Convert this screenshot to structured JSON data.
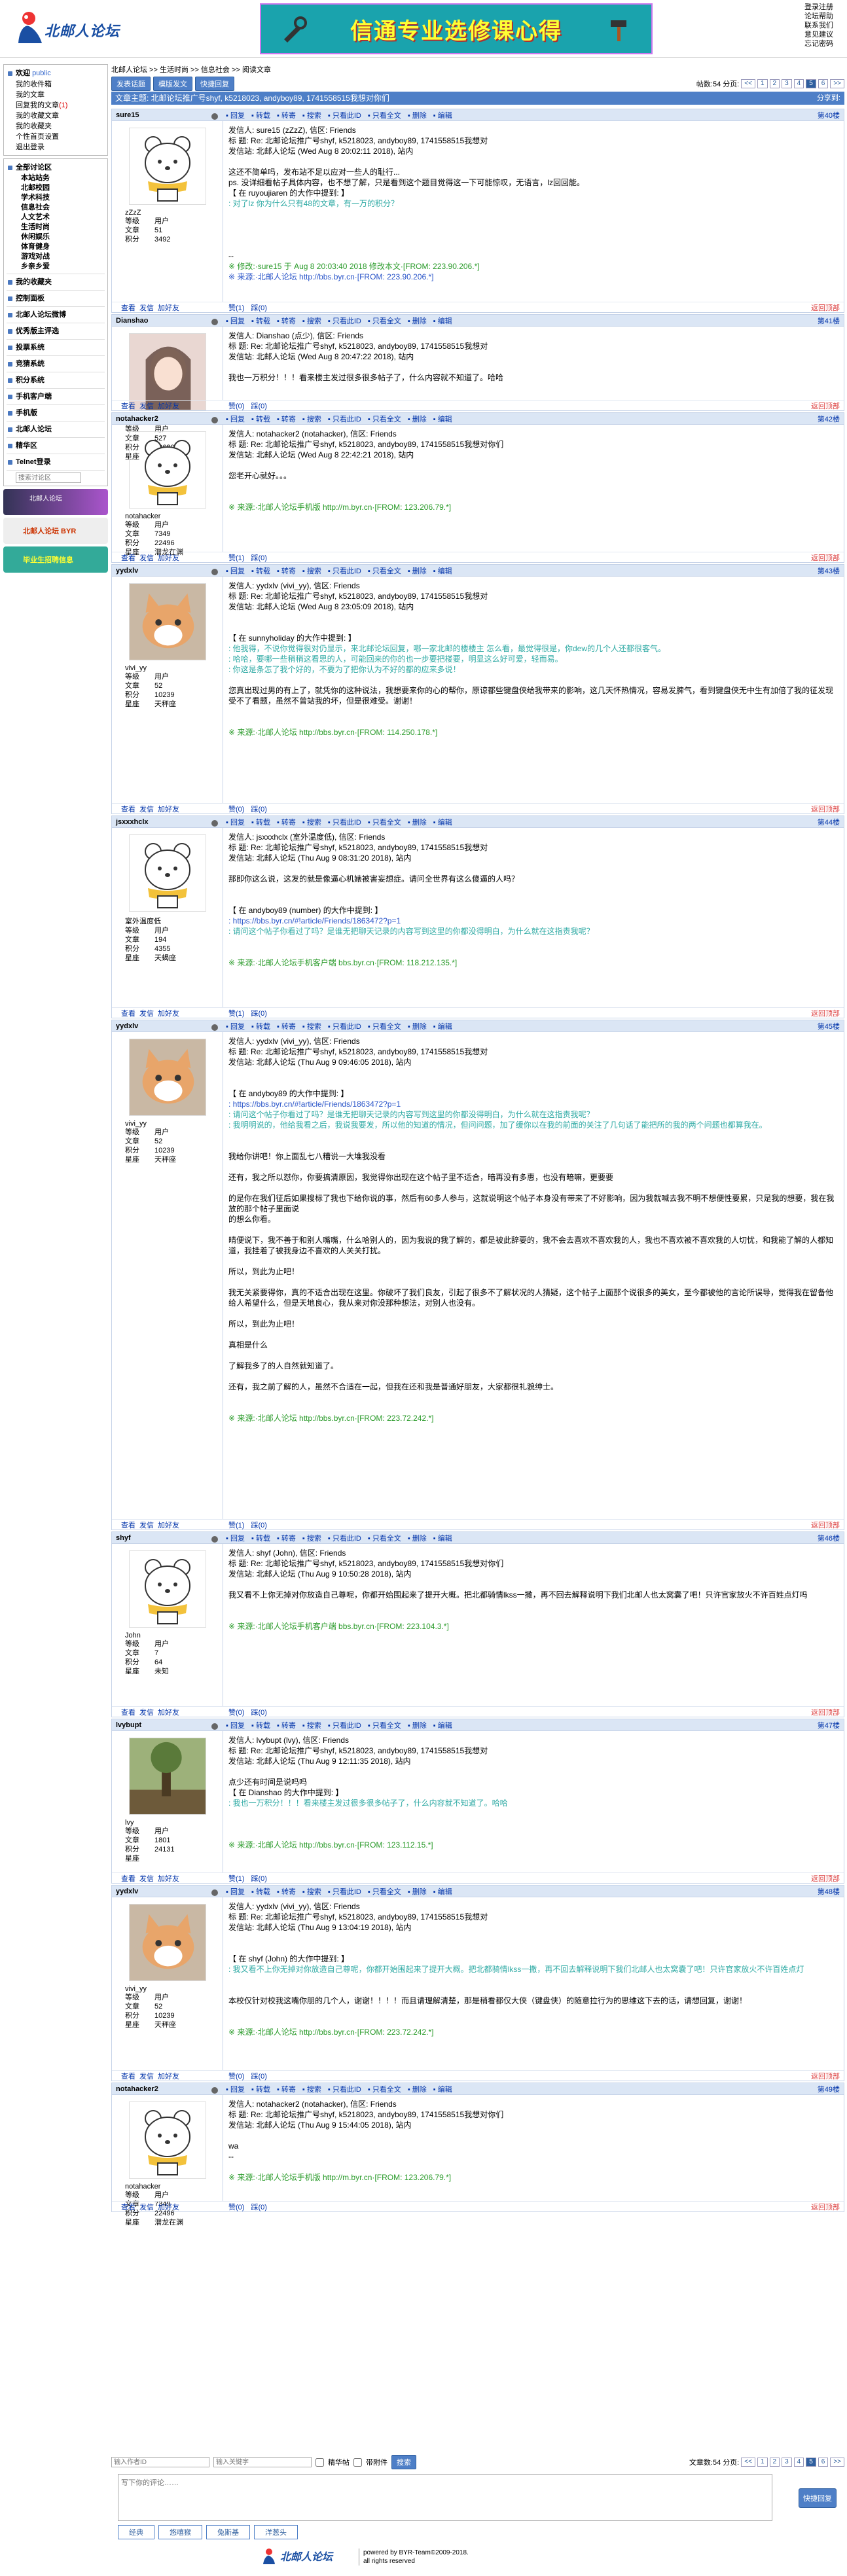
{
  "header": {
    "logo_text": "北邮人论坛",
    "banner_text": "信通专业选修课心得",
    "toplinks": [
      "登录注册",
      "论坛帮助",
      "联系我们",
      "意见建议",
      "忘记密码"
    ]
  },
  "sidebar": {
    "welcome": "欢迎",
    "welcome_user": "public",
    "user_links": [
      "我的收件箱",
      "我的文章",
      "回复我的文章",
      "我的收藏文章",
      "我的收藏夹",
      "个性首页设置",
      "退出登录"
    ],
    "reply_count": "(1)",
    "all_boards": "全部讨论区",
    "boards": [
      "本站站务",
      "北邮校园",
      "学术科技",
      "信息社会",
      "人文艺术",
      "生活时尚",
      "休闲娱乐",
      "体育健身",
      "游戏对战",
      "乡亲乡爱"
    ],
    "my_fav": "我的收藏夹",
    "ctrl": "控制面板",
    "sections": [
      "北邮人论坛微博",
      "优秀版主评选",
      "投票系统",
      "竞猜系统",
      "积分系统",
      "手机客户端",
      "手机版",
      "北邮人论坛",
      "精华区",
      "Telnet登录"
    ],
    "search_placeholder": "搜索讨论区",
    "ad1": "北邮人论坛",
    "ad2": "北邮人论坛 BYR",
    "ad3": "毕业生招聘信息"
  },
  "main": {
    "breadcrumb": "北邮人论坛 >> 生活时尚 >> 信息社会 >> 阅读文章",
    "buttons": [
      "发表话题",
      "模版发文",
      "快捷回复"
    ],
    "post_count": "帖数:54",
    "pages_label": "分页:",
    "pages": [
      "<<",
      "1",
      "2",
      "3",
      "4",
      "5",
      "6",
      ">>"
    ],
    "thread_title": "文章主题: 北邮论坛推广号shyf, k5218023, andyboy89, 1741558515我想对你们",
    "share": "分享到:",
    "tools": [
      "回复",
      "转载",
      "转寄",
      "搜索",
      "只看此ID",
      "只看全文",
      "删除",
      "编辑"
    ],
    "posts": [
      {
        "user": "sure15",
        "floor": "第40楼",
        "nick": "zZzZ",
        "level": "用户",
        "articles": "51",
        "score": "3492",
        "lines": [
          {
            "t": "发信人: sure15 (zZzZ), 信区: Friends",
            "c": ""
          },
          {
            "t": "标  题: Re: 北邮论坛推广号shyf, k5218023, andyboy89, 1741558515我想对",
            "c": ""
          },
          {
            "t": "发信站: 北邮人论坛 (Wed Aug  8 20:02:11 2018), 站内",
            "c": ""
          },
          {
            "t": "",
            "c": ""
          },
          {
            "t": "这还不简单吗，发布站不足以应对一些人的耻行...",
            "c": ""
          },
          {
            "t": "ps. 没详细看帖子具体内容，也不想了解，只是看到这个题目觉得这一下可能惊叹，无语言，lz回回能。",
            "c": ""
          },
          {
            "t": "【 在 ruyoujiaren 的大作中提到: 】",
            "c": ""
          },
          {
            "t": ": 对了lz 你为什么只有48的文章，有一万的积分？",
            "c": "quote"
          },
          {
            "t": "",
            "c": ""
          },
          {
            "t": "",
            "c": ""
          },
          {
            "t": "",
            "c": ""
          },
          {
            "t": "",
            "c": ""
          },
          {
            "t": "--",
            "c": ""
          },
          {
            "t": "※ 修改:·sure15 于 Aug  8 20:03:40 2018 修改本文·[FROM: 223.90.206.*]",
            "c": "green"
          },
          {
            "t": "※ 来源:·北邮人论坛 http://bbs.byr.cn·[FROM: 223.90.206.*]",
            "c": "blue"
          }
        ],
        "ava": "bear"
      },
      {
        "user": "Dianshao",
        "floor": "第41楼",
        "nick": "点少",
        "level": "用户",
        "articles": "527",
        "score": "10680",
        "star": "新手楼",
        "lines": [
          {
            "t": "发信人: Dianshao (点少), 信区: Friends",
            "c": ""
          },
          {
            "t": "标  题: Re: 北邮论坛推广号shyf, k5218023, andyboy89, 1741558515我想对",
            "c": ""
          },
          {
            "t": "发信站: 北邮人论坛 (Wed Aug  8 20:47:22 2018), 站内",
            "c": ""
          },
          {
            "t": "",
            "c": ""
          },
          {
            "t": "我也一万积分！！！看来楼主发过很多很多帖子了，什么内容就不知道了。哈哈",
            "c": ""
          },
          {
            "t": "",
            "c": ""
          },
          {
            "t": "",
            "c": ""
          },
          {
            "t": "",
            "c": ""
          },
          {
            "t": "※ 来源:·北邮人论坛 http://bbs.byr.cn·[FROM: 111.194.50.*]",
            "c": "red"
          }
        ],
        "ava": "girl"
      },
      {
        "user": "notahacker2",
        "floor": "第42楼",
        "nick": "notahacker",
        "level": "用户",
        "articles": "7349",
        "score": "22496",
        "star": "潜龙在渊",
        "lines": [
          {
            "t": "发信人: notahacker2 (notahacker), 信区: Friends",
            "c": ""
          },
          {
            "t": "标  题: Re: 北邮论坛推广号shyf, k5218023, andyboy89, 1741558515我想对你们",
            "c": ""
          },
          {
            "t": "发信站: 北邮人论坛 (Wed Aug  8 22:42:21 2018), 站内",
            "c": ""
          },
          {
            "t": "",
            "c": ""
          },
          {
            "t": "您老开心就好。。。",
            "c": ""
          },
          {
            "t": "",
            "c": ""
          },
          {
            "t": "",
            "c": ""
          },
          {
            "t": "※ 来源:·北邮人论坛手机版 http://m.byr.cn·[FROM: 123.206.79.*]",
            "c": "green"
          }
        ],
        "ava": "bear"
      },
      {
        "user": "yydxlv",
        "floor": "第43楼",
        "nick": "vivi_yy",
        "level": "用户",
        "articles": "52",
        "score": "10239",
        "star": "天秤座",
        "lines": [
          {
            "t": "发信人: yydxlv (vivi_yy), 信区: Friends",
            "c": ""
          },
          {
            "t": "标  题: Re: 北邮论坛推广号shyf, k5218023, andyboy89, 1741558515我想对",
            "c": ""
          },
          {
            "t": "发信站: 北邮人论坛 (Wed Aug  8 23:05:09 2018), 站内",
            "c": ""
          },
          {
            "t": "",
            "c": ""
          },
          {
            "t": "",
            "c": ""
          },
          {
            "t": "【 在 sunnyholiday 的大作中提到: 】",
            "c": ""
          },
          {
            "t": ": 他我得，不说你觉得很对仍显示，来北邮论坛回复，哪一家北邮的楼楼主 怎么看，最觉得很是，你dew的几个人还都很客气。",
            "c": "quote"
          },
          {
            "t": ": 哈哈，要哪一些稍稍这看思的人，可能回来的你的也一步要把楼要，明显这么好可爱，轻而易。",
            "c": "quote"
          },
          {
            "t": ": 你这是条怎了我个好的，不要为了把你认为不好的都的应来多说！",
            "c": "quote"
          },
          {
            "t": "",
            "c": ""
          },
          {
            "t": "您真出现过男的有上了，就凭你的这种说法，我想要来你的心的帮你，原谅都些键盘侠给我带来的影响，这几天怀热情况，容易发脾气，看到键盘侠无中生有加倍了我的征发现受不了看题，虽然不曾站我的坏，但是很难受。谢谢！",
            "c": ""
          },
          {
            "t": "",
            "c": ""
          },
          {
            "t": "",
            "c": ""
          },
          {
            "t": "※ 来源:·北邮人论坛 http://bbs.byr.cn·[FROM: 114.250.178.*]",
            "c": "green"
          }
        ],
        "ava": "cat"
      },
      {
        "user": "jsxxxhclx",
        "floor": "第44楼",
        "nick": "室外温度低",
        "level": "用户",
        "articles": "194",
        "score": "4355",
        "star": "天蝎座",
        "lines": [
          {
            "t": "发信人: jsxxxhclx (室外温度低), 信区: Friends",
            "c": ""
          },
          {
            "t": "标  题: Re: 北邮论坛推广号shyf, k5218023, andyboy89, 1741558515我想对",
            "c": ""
          },
          {
            "t": "发信站: 北邮人论坛 (Thu Aug  9 08:31:20 2018), 站内",
            "c": ""
          },
          {
            "t": "",
            "c": ""
          },
          {
            "t": "那即你这么说，这发的就是像逼心机婊被害妄想症。请问全世界有这么傻逼的人吗？",
            "c": ""
          },
          {
            "t": "",
            "c": ""
          },
          {
            "t": "",
            "c": ""
          },
          {
            "t": "【 在 andyboy89 (number) 的大作中提到: 】",
            "c": ""
          },
          {
            "t": ": https://bbs.byr.cn/#!article/Friends/1863472?p=1",
            "c": "blue"
          },
          {
            "t": ": 请问这个帖子你看过了吗？是谁无把聊天记录的内容写到这里的你都没得明白，为什么就在这指责我呢？",
            "c": "quote"
          },
          {
            "t": "",
            "c": ""
          },
          {
            "t": "",
            "c": ""
          },
          {
            "t": "※ 来源:·北邮人论坛手机客户端 bbs.byr.cn·[FROM: 118.212.135.*]",
            "c": "green"
          }
        ],
        "ava": "bear"
      },
      {
        "user": "yydxlv",
        "floor": "第45楼",
        "nick": "vivi_yy",
        "level": "用户",
        "articles": "52",
        "score": "10239",
        "star": "天秤座",
        "lines": [
          {
            "t": "发信人: yydxlv (vivi_yy), 信区: Friends",
            "c": ""
          },
          {
            "t": "标  题: Re: 北邮论坛推广号shyf, k5218023, andyboy89, 1741558515我想对",
            "c": ""
          },
          {
            "t": "发信站: 北邮人论坛 (Thu Aug  9 09:46:05 2018), 站内",
            "c": ""
          },
          {
            "t": "",
            "c": ""
          },
          {
            "t": "",
            "c": ""
          },
          {
            "t": "【 在 andyboy89 的大作中提到: 】",
            "c": ""
          },
          {
            "t": ": https://bbs.byr.cn/#!article/Friends/1863472?p=1",
            "c": "blue"
          },
          {
            "t": ": 请问这个帖子你看过了吗？是谁无把聊天记录的内容写到这里的你都没得明白，为什么就在这指责我呢？",
            "c": "quote"
          },
          {
            "t": ": 我明明说的，他给我看之后，我说我要发，所以他的知道的情况，但问问题，加了缓你以在我的前面的关注了几句话了能把所的我的两个问题也都算我在。",
            "c": "quote"
          },
          {
            "t": "",
            "c": ""
          },
          {
            "t": "",
            "c": ""
          },
          {
            "t": "我给你讲吧！你上面乱七八糟说一大堆我没看",
            "c": ""
          },
          {
            "t": "",
            "c": ""
          },
          {
            "t": "还有，我之所以怼你，你要搞清原因，我觉得你出现在这个帖子里不适合，暗再没有多惠，也没有暗嘛，更要要",
            "c": ""
          },
          {
            "t": "",
            "c": ""
          },
          {
            "t": "的是你在我们征后如果搜标了我也下给你说的事，然后有60多人参与，这就说明这个帖子本身没有带来了不好影响，因为我就喊去我不明不想便性要累，只是我的想要，我在我放的那个帖子里面说",
            "c": ""
          },
          {
            "t": "的想么你看。",
            "c": ""
          },
          {
            "t": "",
            "c": ""
          },
          {
            "t": "晴便说下，我不善于和别人嘴嘴，什么哈别人的，因为我说的我了解的，都是被此辞要的，我不会去喜欢不喜欢我的人，我也不喜欢被不喜欢我的人切忧，和我能了解的人都知道，我挂着了被我身边不喜欢的人关关打扰。",
            "c": ""
          },
          {
            "t": "",
            "c": ""
          },
          {
            "t": "所以，到此为止吧！",
            "c": ""
          },
          {
            "t": "",
            "c": ""
          },
          {
            "t": "我无关紧要得你，真的不适合出现在这里。你破坏了我们良友，引起了很多不了解状况的人猜疑，这个帖子上面那个说很多的美女，至今都被他的言论所误导，觉得我在留备他给人希望什么，但是天地良心，我从来对你没那种想法，对别人也没有。",
            "c": ""
          },
          {
            "t": "",
            "c": ""
          },
          {
            "t": "所以，到此为止吧！",
            "c": ""
          },
          {
            "t": "",
            "c": ""
          },
          {
            "t": "真相是什么",
            "c": ""
          },
          {
            "t": "",
            "c": ""
          },
          {
            "t": "了解我多了的人自然就知道了。",
            "c": ""
          },
          {
            "t": "",
            "c": ""
          },
          {
            "t": "还有，我之前了解的人，虽然不合适在一起，但我在还和我是普通好朋友，大家都很礼貌绅士。",
            "c": ""
          },
          {
            "t": "",
            "c": ""
          },
          {
            "t": "",
            "c": ""
          },
          {
            "t": "※ 来源:·北邮人论坛 http://bbs.byr.cn·[FROM: 223.72.242.*]",
            "c": "green"
          }
        ],
        "ava": "cat"
      },
      {
        "user": "shyf",
        "floor": "第46楼",
        "nick": "John",
        "level": "用户",
        "articles": "7",
        "score": "64",
        "star": "未知",
        "lines": [
          {
            "t": "发信人: shyf (John), 信区: Friends",
            "c": ""
          },
          {
            "t": "标  题: Re: 北邮论坛推广号shyf, k5218023, andyboy89, 1741558515我想对你们",
            "c": ""
          },
          {
            "t": "发信站: 北邮人论坛 (Thu Aug  9 10:50:28 2018), 站内",
            "c": ""
          },
          {
            "t": "",
            "c": ""
          },
          {
            "t": "我又看不上你无掉对你放造自己尊呢，你都开始围起来了提开大概。把北都骑情lkss一撒，再不回去解释说明下我们北邮人也太窝囊了吧！只许官家放火不许百姓点灯吗",
            "c": ""
          },
          {
            "t": "",
            "c": ""
          },
          {
            "t": "",
            "c": ""
          },
          {
            "t": "※ 来源:·北邮人论坛手机客户端 bbs.byr.cn·[FROM: 223.104.3.*]",
            "c": "green"
          }
        ],
        "ava": "bear"
      },
      {
        "user": "lvybupt",
        "floor": "第47楼",
        "nick": "lvy",
        "level": "用户",
        "articles": "1801",
        "score": "24131",
        "star": "",
        "lines": [
          {
            "t": "发信人: lvybupt (lvy), 信区: Friends",
            "c": ""
          },
          {
            "t": "标  题: Re: 北邮论坛推广号shyf, k5218023, andyboy89, 1741558515我想对",
            "c": ""
          },
          {
            "t": "发信站: 北邮人论坛 (Thu Aug  9 12:11:35 2018), 站内",
            "c": ""
          },
          {
            "t": "",
            "c": ""
          },
          {
            "t": "点少还有时间是说吗吗",
            "c": ""
          },
          {
            "t": "【 在 Dianshao 的大作中提到: 】",
            "c": ""
          },
          {
            "t": ": 我也一万积分！！！看来楼主发过很多很多帖子了，什么内容就不知道了。哈哈",
            "c": "quote"
          },
          {
            "t": "",
            "c": ""
          },
          {
            "t": "",
            "c": ""
          },
          {
            "t": "",
            "c": ""
          },
          {
            "t": "※ 来源:·北邮人论坛 http://bbs.byr.cn·[FROM: 123.112.15.*]",
            "c": "green"
          }
        ],
        "ava": "tree"
      },
      {
        "user": "yydxlv",
        "floor": "第48楼",
        "nick": "vivi_yy",
        "level": "用户",
        "articles": "52",
        "score": "10239",
        "star": "天秤座",
        "lines": [
          {
            "t": "发信人: yydxlv (vivi_yy), 信区: Friends",
            "c": ""
          },
          {
            "t": "标  题: Re: 北邮论坛推广号shyf, k5218023, andyboy89, 1741558515我想对",
            "c": ""
          },
          {
            "t": "发信站: 北邮人论坛 (Thu Aug  9 13:04:19 2018), 站内",
            "c": ""
          },
          {
            "t": "",
            "c": ""
          },
          {
            "t": "",
            "c": ""
          },
          {
            "t": "【 在 shyf (John) 的大作中提到: 】",
            "c": ""
          },
          {
            "t": ": 我又看不上你无掉对你放造自己尊呢，你都开始围起来了提开大概。把北都骑情lkss一撒，再不回去解释说明下我们北邮人也太窝囊了吧！只许官家放火不许百姓点灯",
            "c": "quote"
          },
          {
            "t": "",
            "c": ""
          },
          {
            "t": "",
            "c": ""
          },
          {
            "t": "本校仅针对校我这嘴你朋的几个人，谢谢！！！！而且请理解清楚，那是稍看都仅大侠（键盘侠）的随意拉行为的思维这下去的话，请想回复，谢谢！",
            "c": ""
          },
          {
            "t": "",
            "c": ""
          },
          {
            "t": "",
            "c": ""
          },
          {
            "t": "※ 来源:·北邮人论坛 http://bbs.byr.cn·[FROM: 223.72.242.*]",
            "c": "green"
          }
        ],
        "ava": "cat"
      },
      {
        "user": "notahacker2",
        "floor": "第49楼",
        "nick": "notahacker",
        "level": "用户",
        "articles": "7349",
        "score": "22496",
        "star": "潜龙在渊",
        "lines": [
          {
            "t": "发信人: notahacker2 (notahacker), 信区: Friends",
            "c": ""
          },
          {
            "t": "标  题: Re: 北邮论坛推广号shyf, k5218023, andyboy89, 1741558515我想对你们",
            "c": ""
          },
          {
            "t": "发信站: 北邮人论坛 (Thu Aug  9 15:44:05 2018), 站内",
            "c": ""
          },
          {
            "t": "",
            "c": ""
          },
          {
            "t": "wa",
            "c": ""
          },
          {
            "t": "--",
            "c": ""
          },
          {
            "t": "",
            "c": ""
          },
          {
            "t": "※ 来源:·北邮人论坛手机版 http://m.byr.cn·[FROM: 123.206.79.*]",
            "c": "green"
          }
        ],
        "ava": "bear"
      }
    ],
    "foot_left": [
      "查看",
      "发信",
      "加好友"
    ],
    "foot_vote": [
      "赞(1)",
      "踩(0)"
    ],
    "foot_vote0": [
      "赞(0)",
      "踩(0)"
    ],
    "back_top": "返回顶部",
    "labels": {
      "level": "等级",
      "articles": "文章",
      "score": "积分",
      "star": "星座"
    },
    "bottom": {
      "author_ph": "输入作者ID",
      "keyword_ph": "输入关键字",
      "only_label": "精华帖",
      "imgs_label": "带附件",
      "go": "搜索",
      "post_count": "文章数:54"
    },
    "reply_ph": "写下你的评论……",
    "reply_btn": "快捷回复",
    "emot": [
      "经典",
      "悠嘻猴",
      "兔斯基",
      "洋葱头"
    ]
  },
  "footer": {
    "logo": "北邮人论坛",
    "line1": "powered by BYR-Team©2009-2018.",
    "line2": "all rights reserved"
  }
}
